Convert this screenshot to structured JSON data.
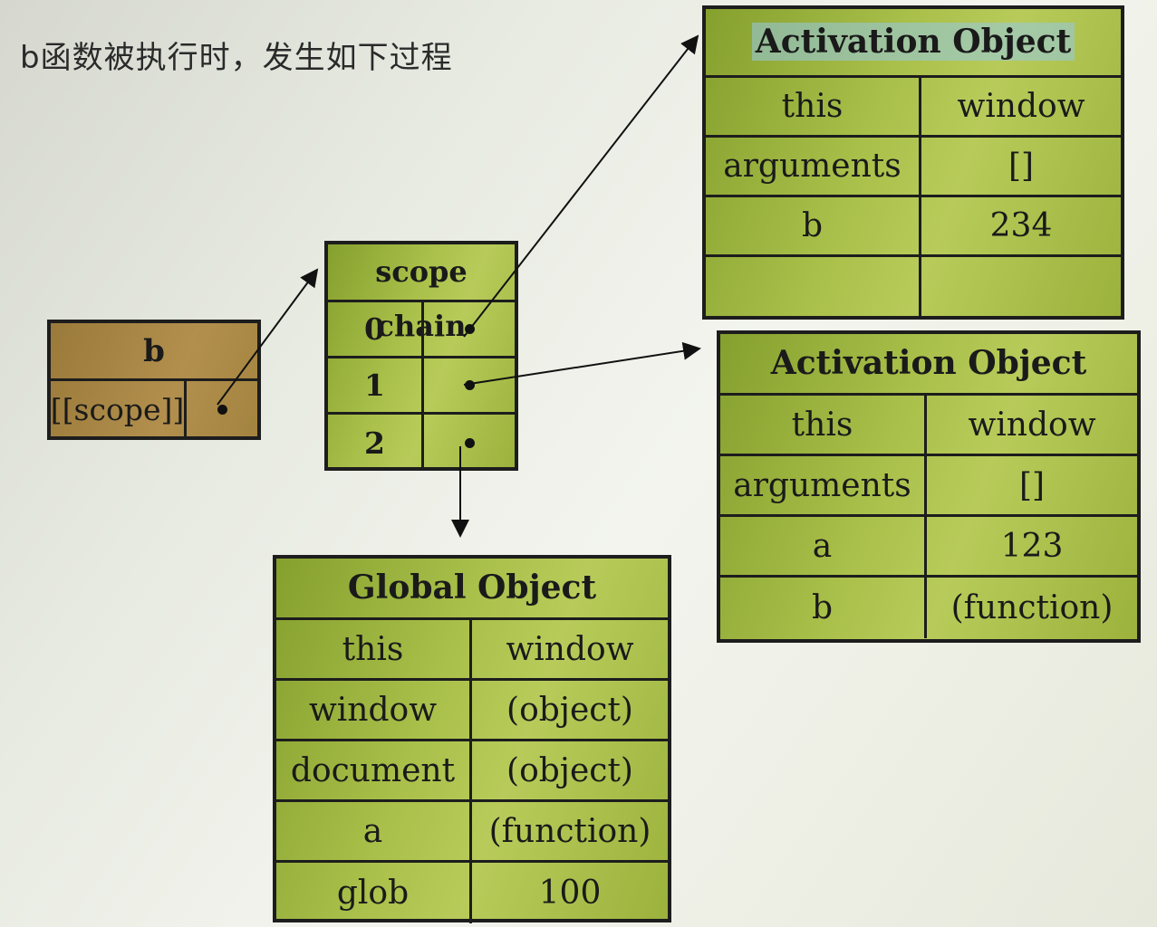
{
  "heading": "b函数被执行时，发生如下过程",
  "b_box": {
    "title": "b",
    "scope_label": "[[scope]]"
  },
  "scope_chain": {
    "title": "scope chain",
    "rows": [
      "0",
      "1",
      "2"
    ]
  },
  "activation_top": {
    "title": "Activation Object",
    "rows": [
      {
        "key": "this",
        "value": "window"
      },
      {
        "key": "arguments",
        "value": "[]"
      },
      {
        "key": "b",
        "value": "234"
      },
      {
        "key": "",
        "value": ""
      }
    ]
  },
  "activation_right": {
    "title": "Activation Object",
    "rows": [
      {
        "key": "this",
        "value": "window"
      },
      {
        "key": "arguments",
        "value": "[]"
      },
      {
        "key": "a",
        "value": "123"
      },
      {
        "key": "b",
        "value": "(function)"
      }
    ]
  },
  "global": {
    "title": "Global Object",
    "rows": [
      {
        "key": "this",
        "value": "window"
      },
      {
        "key": "window",
        "value": "(object)"
      },
      {
        "key": "document",
        "value": "(object)"
      },
      {
        "key": "a",
        "value": "(function)"
      },
      {
        "key": "glob",
        "value": "100"
      }
    ]
  }
}
